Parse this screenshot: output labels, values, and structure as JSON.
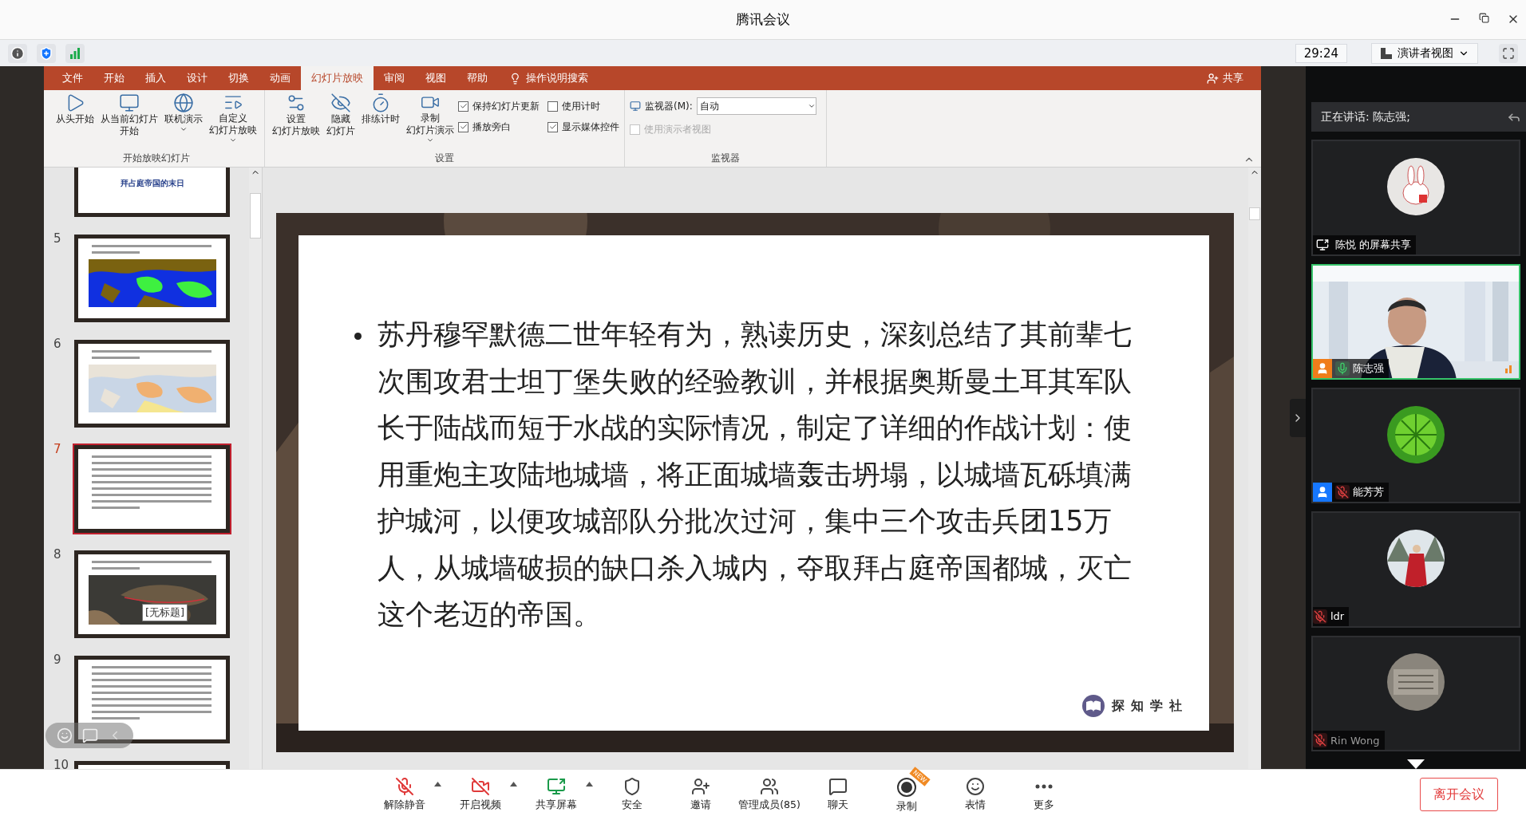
{
  "window": {
    "title": "腾讯会议"
  },
  "meeting_bar": {
    "timer": "29:24",
    "view_mode": "演讲者视图"
  },
  "ppt": {
    "tabs": [
      {
        "label": "文件",
        "selected": false
      },
      {
        "label": "开始",
        "selected": false
      },
      {
        "label": "插入",
        "selected": false
      },
      {
        "label": "设计",
        "selected": false
      },
      {
        "label": "切换",
        "selected": false
      },
      {
        "label": "动画",
        "selected": false
      },
      {
        "label": "幻灯片放映",
        "selected": true
      },
      {
        "label": "审阅",
        "selected": false
      },
      {
        "label": "视图",
        "selected": false
      },
      {
        "label": "帮助",
        "selected": false
      }
    ],
    "search": "操作说明搜索",
    "share": "共享",
    "ribbon_groups": [
      {
        "title": "开始放映幻灯片",
        "items": [
          {
            "kind": "big",
            "label": [
              "从头开始"
            ],
            "dropdown": false
          },
          {
            "kind": "big",
            "label": [
              "从当前幻灯片",
              "开始"
            ],
            "dropdown": false
          },
          {
            "kind": "big",
            "label": [
              "联机演示"
            ],
            "dropdown": true
          },
          {
            "kind": "big",
            "label": [
              "自定义",
              "幻灯片放映"
            ],
            "dropdown": true
          }
        ]
      },
      {
        "title": "设置",
        "items": [
          {
            "kind": "big",
            "label": [
              "设置",
              "幻灯片放映"
            ],
            "dropdown": false
          },
          {
            "kind": "big",
            "label": [
              "隐藏",
              "幻灯片"
            ],
            "dropdown": false
          },
          {
            "kind": "big",
            "label": [
              "排练计时"
            ],
            "dropdown": false
          },
          {
            "kind": "big",
            "label": [
              "录制",
              "幻灯片演示"
            ],
            "dropdown": true
          },
          {
            "kind": "check",
            "label": "保持幻灯片更新",
            "checked": true,
            "disabled": false
          },
          {
            "kind": "check",
            "label": "播放旁白",
            "checked": true,
            "disabled": false
          },
          {
            "kind": "check",
            "label": "使用计时",
            "checked": false,
            "disabled": false
          },
          {
            "kind": "check",
            "label": "显示媒体控件",
            "checked": true,
            "disabled": false
          }
        ]
      },
      {
        "title": "监视器",
        "items": [
          {
            "kind": "select",
            "label": "监视器(M):",
            "value": "自动"
          },
          {
            "kind": "check",
            "label": "使用演示者视图",
            "checked": false,
            "disabled": true
          }
        ]
      }
    ]
  },
  "slides": [
    {
      "kind": "title",
      "title": "拜占庭帝国的末日",
      "selected": false
    },
    {
      "number": "5",
      "kind": "map",
      "selected": false
    },
    {
      "number": "6",
      "kind": "atlas",
      "selected": false
    },
    {
      "number": "7",
      "kind": "text",
      "selected": true
    },
    {
      "number": "8",
      "tooltip": "[无标题]",
      "selected": false
    },
    {
      "number": "9",
      "kind": "text",
      "selected": false
    },
    {
      "number": "10",
      "kind": "blank",
      "selected": false
    }
  ],
  "slide": {
    "bullets": [
      "苏丹穆罕默德二世年轻有为，熟读历史，深刻总结了其前辈七次围攻君士坦丁堡失败的经验教训，并根据奥斯曼土耳其军队长于陆战而短于水战的实际情况，制定了详细的作战计划：使用重炮主攻陆地城墙，将正面城墙轰击坍塌，以城墙瓦砾填满护城河，以便攻城部队分批次过河，集中三个攻击兵团15万人，从城墙破损的缺口杀入城内，夺取拜占庭帝国都城，灭亡这个老迈的帝国。"
    ],
    "logo_text": "探知学社"
  },
  "speaking": {
    "label": "正在讲话: 陈志强;"
  },
  "participants": [
    {
      "kind": "screen_share",
      "name": "陈悦 的屏幕共享",
      "speaking": false,
      "dimmed": false
    },
    {
      "kind": "video",
      "name": "陈志强",
      "color": "#f07d1a",
      "speaking": true,
      "muted": false,
      "dimmed": false
    },
    {
      "kind": "avatar",
      "name": "能芳芳",
      "color": "#1677ff",
      "speaking": false,
      "muted": true,
      "dimmed": false
    },
    {
      "kind": "avatar",
      "name": "ldr",
      "speaking": false,
      "muted": true,
      "dimmed": false
    },
    {
      "kind": "avatar",
      "name": "Rin Wong",
      "speaking": false,
      "muted": true,
      "dimmed": true
    }
  ],
  "toolbar": [
    {
      "kind": "mute",
      "label": "解除静音",
      "menu": true
    },
    {
      "kind": "video",
      "label": "开启视频",
      "menu": true
    },
    {
      "kind": "share",
      "label": "共享屏幕",
      "menu": true
    },
    {
      "kind": "security",
      "label": "安全",
      "menu": false
    },
    {
      "kind": "invite",
      "label": "邀请",
      "menu": false
    },
    {
      "kind": "members",
      "label": "管理成员(85)",
      "menu": false
    },
    {
      "kind": "chat",
      "label": "聊天",
      "menu": false
    },
    {
      "kind": "record",
      "label": "录制",
      "menu": false,
      "badge": "NEW"
    },
    {
      "kind": "emoji",
      "label": "表情",
      "menu": false
    },
    {
      "kind": "more",
      "label": "更多",
      "menu": false
    }
  ],
  "leave_button": "离开会议"
}
